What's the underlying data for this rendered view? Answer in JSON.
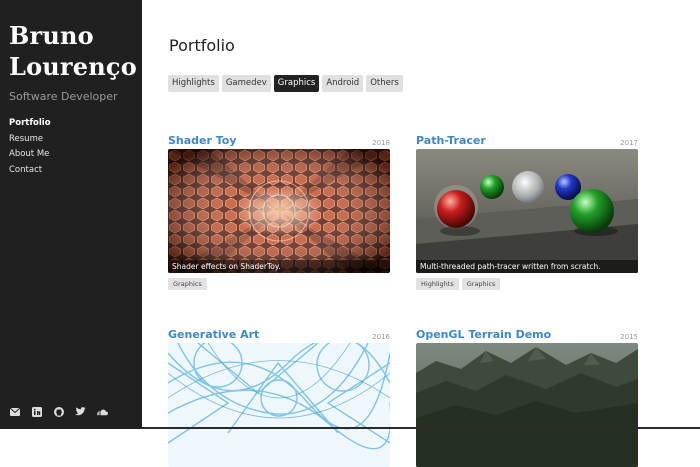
{
  "sidebar": {
    "brand_line1": "Bruno",
    "brand_line2": "Lourenço",
    "tagline": "Software Developer",
    "nav": [
      "Portfolio",
      "Resume",
      "About Me",
      "Contact"
    ],
    "social_icons": [
      "email-icon",
      "linkedin-icon",
      "github-icon",
      "twitter-icon",
      "soundcloud-icon"
    ]
  },
  "main": {
    "title": "Portfolio",
    "tabs": [
      "Highlights",
      "Gamedev",
      "Graphics",
      "Android",
      "Others"
    ],
    "active_tab": "Graphics",
    "cards": [
      {
        "title": "Shader Toy",
        "year": "2018",
        "caption": "Shader effects on ShaderToy.",
        "tags": [
          "Graphics"
        ]
      },
      {
        "title": "Path-Tracer",
        "year": "2017",
        "caption": "Multi-threaded path-tracer written from scratch.",
        "tags": [
          "Highlights",
          "Graphics"
        ]
      },
      {
        "title": "Generative Art",
        "year": "2016",
        "caption": "",
        "tags": []
      },
      {
        "title": "OpenGL Terrain Demo",
        "year": "2015",
        "caption": "",
        "tags": []
      }
    ]
  },
  "colors": {
    "sidebar_bg": "#202020",
    "link": "#3f87c6",
    "active_tab": "#222222"
  }
}
